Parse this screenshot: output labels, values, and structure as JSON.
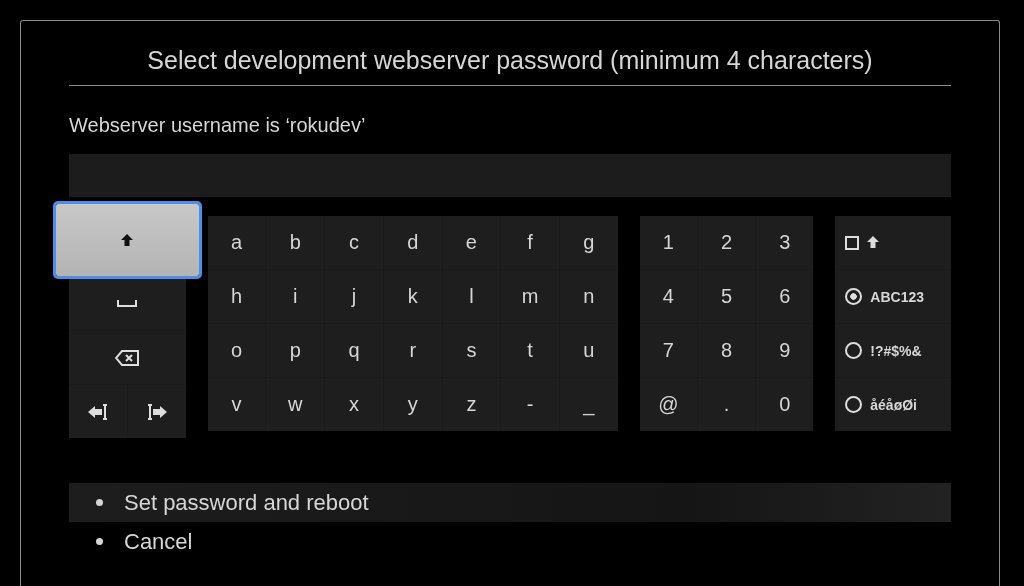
{
  "dialog": {
    "title": "Select development webserver password (minimum 4 characters)",
    "username_label": "Webserver username is ‘rokudev’"
  },
  "keyboard": {
    "special_keys": [
      {
        "kind": "shift",
        "selected": true
      },
      {
        "kind": "space",
        "selected": false
      },
      {
        "kind": "backspace",
        "selected": false
      },
      {
        "kind": "cursor-left",
        "selected": false
      },
      {
        "kind": "cursor-right",
        "selected": false
      }
    ],
    "letters": [
      "a",
      "b",
      "c",
      "d",
      "e",
      "f",
      "g",
      "h",
      "i",
      "j",
      "k",
      "l",
      "m",
      "n",
      "o",
      "p",
      "q",
      "r",
      "s",
      "t",
      "u",
      "v",
      "w",
      "x",
      "y",
      "z",
      "-",
      "_"
    ],
    "numbers": [
      "1",
      "2",
      "3",
      "4",
      "5",
      "6",
      "7",
      "8",
      "9",
      "@",
      ".",
      "0"
    ],
    "modes": [
      {
        "kind": "checkbox",
        "checked": false
      },
      {
        "kind": "radio",
        "label": "ABC123",
        "selected": true
      },
      {
        "kind": "radio",
        "label": "!?#$%&",
        "selected": false
      },
      {
        "kind": "radio",
        "label": "åéåøØi",
        "selected": false
      }
    ]
  },
  "menu": [
    {
      "label": "Set password and reboot",
      "selected": true
    },
    {
      "label": "Cancel",
      "selected": false
    }
  ]
}
